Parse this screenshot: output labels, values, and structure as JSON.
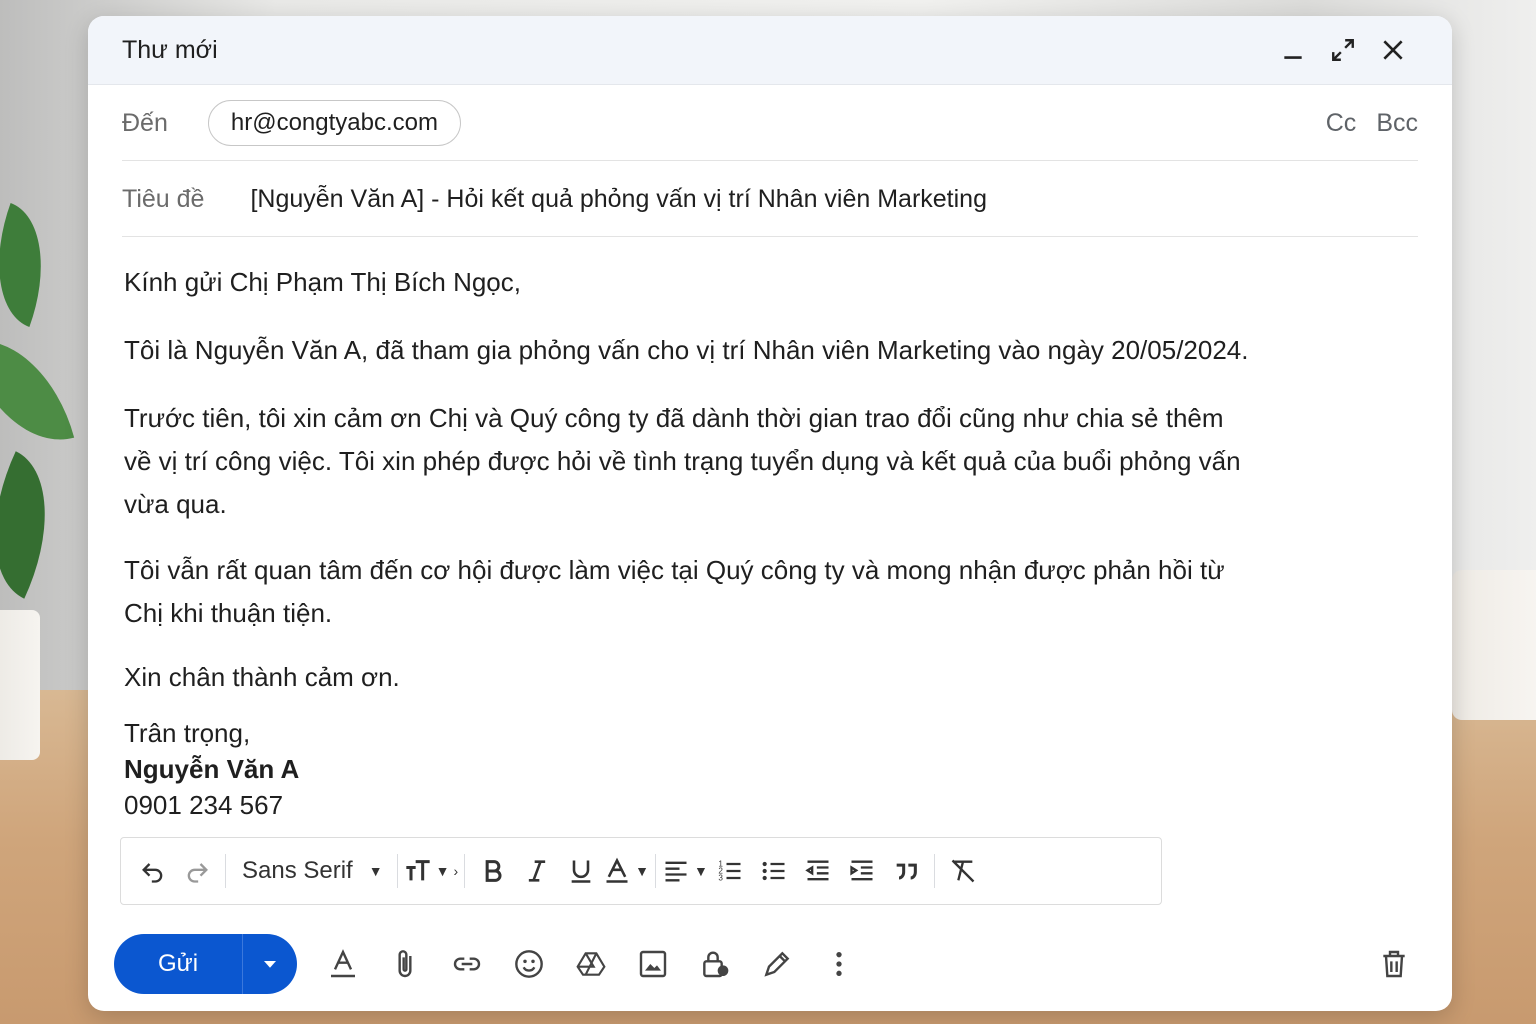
{
  "window": {
    "title": "Thư mới"
  },
  "recipients": {
    "to_label": "Đến",
    "to_value": "hr@congtyabc.com",
    "cc_label": "Cc",
    "bcc_label": "Bcc"
  },
  "subject": {
    "label": "Tiêu đề",
    "value": "[Nguyễn Văn A] - Hỏi kết quả phỏng vấn vị trí Nhân viên Marketing"
  },
  "body": {
    "greeting": "Kính gửi Chị Phạm Thị Bích Ngọc,",
    "p1": "Tôi là Nguyễn Văn A, đã tham gia phỏng vấn cho vị trí Nhân viên Marketing vào ngày 20/05/2024.",
    "p2_l1": "Trước tiên, tôi xin cảm ơn Chị và Quý công ty đã dành thời gian trao đổi cũng như chia sẻ thêm",
    "p2_l2": "về vị trí công việc. Tôi xin phép được hỏi về tình trạng tuyển dụng và kết quả của buổi phỏng vấn",
    "p2_l3": "vừa qua.",
    "p3_l1": "Tôi vẫn rất quan tâm đến cơ hội được làm việc tại Quý công ty và mong nhận được phản hồi từ",
    "p3_l2": "Chị khi thuận tiện.",
    "thanks": "Xin chân thành cảm ơn.",
    "closing": "Trân trọng,",
    "sender_name": "Nguyễn Văn A",
    "sender_phone": "0901 234 567"
  },
  "toolbar": {
    "font_name": "Sans Serif",
    "icons": [
      "undo-icon",
      "redo-icon",
      "font-size-icon",
      "bold-icon",
      "italic-icon",
      "underline-icon",
      "text-color-icon",
      "align-icon",
      "numbered-list-icon",
      "bulleted-list-icon",
      "indent-less-icon",
      "indent-more-icon",
      "quote-icon",
      "remove-formatting-icon"
    ]
  },
  "actions": {
    "send_label": "Gửi",
    "icons": [
      "formatting-icon",
      "attach-icon",
      "link-icon",
      "emoji-icon",
      "drive-icon",
      "photo-icon",
      "confidential-lock-icon",
      "signature-pen-icon",
      "more-options-icon",
      "trash-icon"
    ]
  },
  "colors": {
    "send_button": "#0b57d0",
    "titlebar_bg": "#f2f5fa",
    "text": "#1f1f1f",
    "muted_text": "#6b6b6b"
  }
}
